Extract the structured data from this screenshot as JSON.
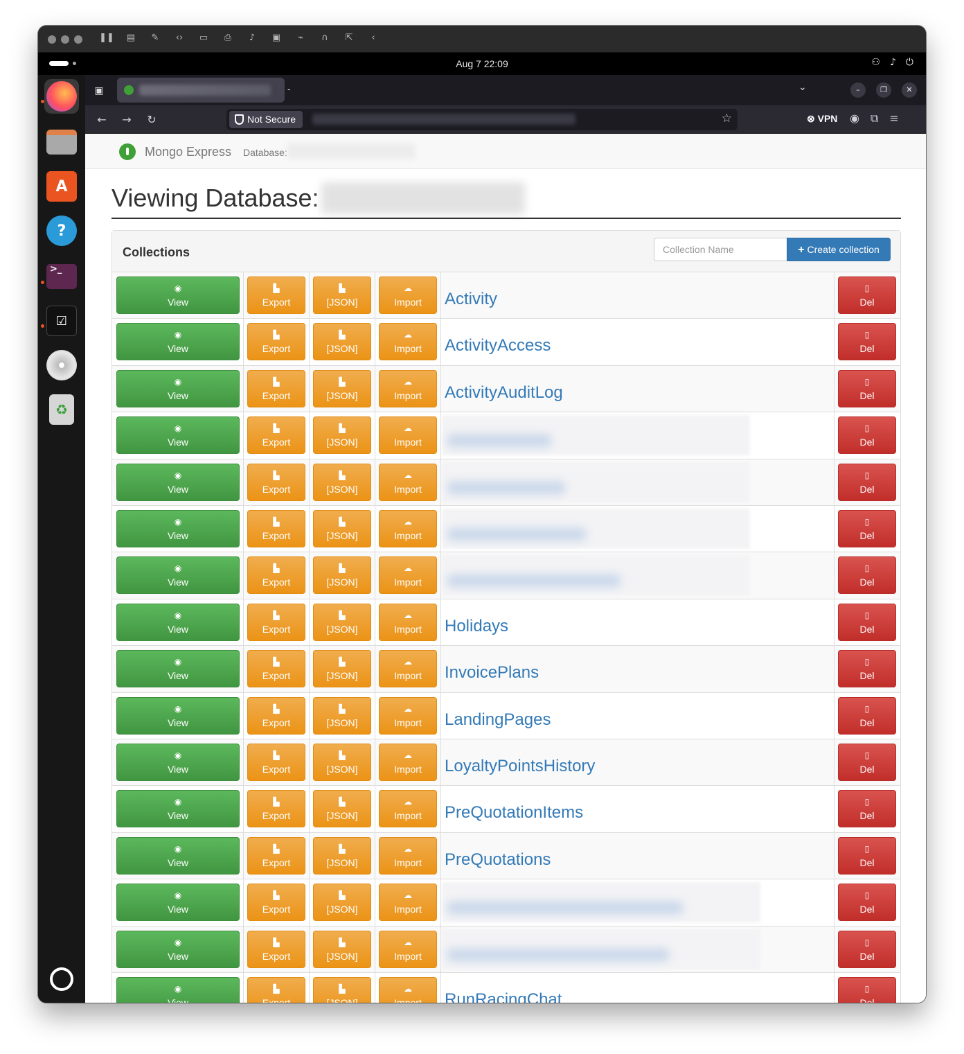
{
  "vm_toolbar": {
    "icons": [
      "pause-icon",
      "snapshot-icon",
      "settings-wrench-icon",
      "code-icon",
      "drive-icon",
      "printer-icon",
      "audio-icon",
      "camera-icon",
      "usb-icon",
      "headphone-icon",
      "share-icon",
      "back-chevron-icon"
    ]
  },
  "topbar": {
    "date": "Aug 7",
    "time": "22:09",
    "clock": "Aug 7  22:09",
    "status_icons": [
      "network-icon",
      "volume-icon",
      "power-icon"
    ]
  },
  "dock": {
    "items": [
      "firefox",
      "files",
      "app-center",
      "help",
      "terminal",
      "text-editor",
      "disc",
      "trash",
      "show-apps"
    ]
  },
  "browser": {
    "tab_separator": "-",
    "security_label": "Not Secure",
    "vpn_label": "VPN"
  },
  "app": {
    "brand": "Mongo Express",
    "database_label": "Database:",
    "heading": "Viewing Database:",
    "panel_title": "Collections",
    "collection_input_placeholder": "Collection Name",
    "create_button_label": "Create collection",
    "button_labels": {
      "view": "View",
      "export": "Export",
      "json": "[JSON]",
      "import": "Import",
      "del": "Del"
    },
    "collections": [
      {
        "name": "Activity",
        "redacted": false
      },
      {
        "name": "ActivityAccess",
        "redacted": false
      },
      {
        "name": "ActivityAuditLog",
        "redacted": false
      },
      {
        "name": "",
        "redacted": true
      },
      {
        "name": "",
        "redacted": true
      },
      {
        "name": "",
        "redacted": true
      },
      {
        "name": "",
        "redacted": true
      },
      {
        "name": "Holidays",
        "redacted": false
      },
      {
        "name": "InvoicePlans",
        "redacted": false
      },
      {
        "name": "LandingPages",
        "redacted": false
      },
      {
        "name": "LoyaltyPointsHistory",
        "redacted": false
      },
      {
        "name": "PreQuotationItems",
        "redacted": false
      },
      {
        "name": "PreQuotations",
        "redacted": false
      },
      {
        "name": "",
        "redacted": true
      },
      {
        "name": "",
        "redacted": true
      },
      {
        "name": "RunRacingChat",
        "redacted": false
      }
    ]
  },
  "colors": {
    "view_green": "#5cb85c",
    "export_orange": "#f0ad4e",
    "delete_red": "#d9534f",
    "primary_blue": "#337ab7",
    "link_blue": "#337ab7"
  }
}
